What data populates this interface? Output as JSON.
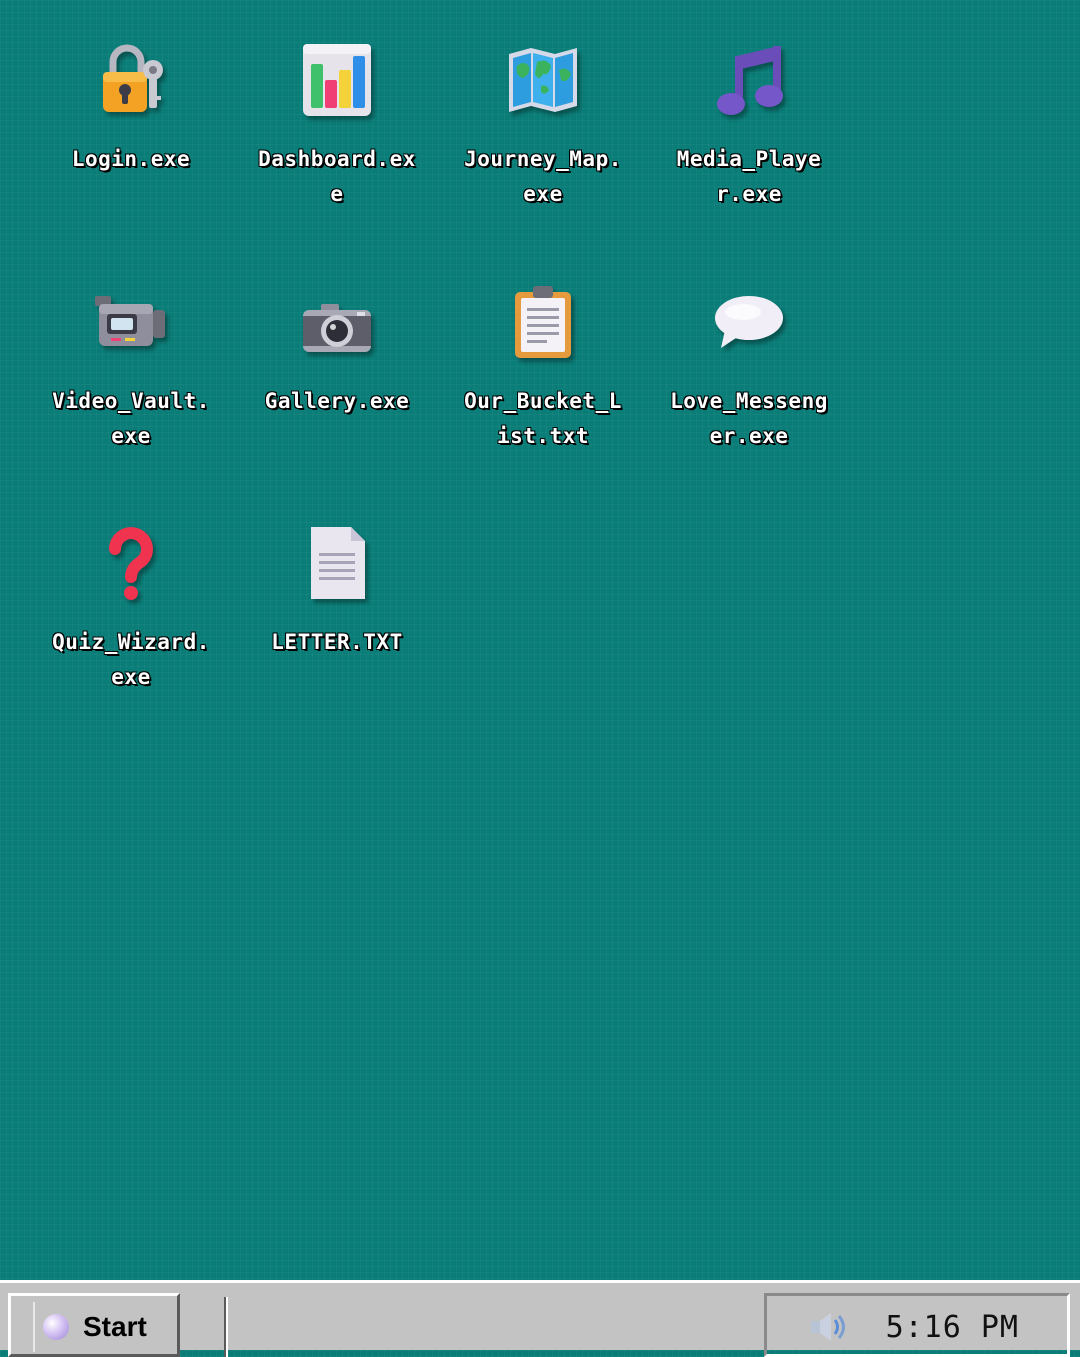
{
  "desktop": {
    "icons": [
      {
        "label": "Login.exe",
        "icon": "lock-key-icon"
      },
      {
        "label": "Dashboard.exe",
        "icon": "bar-chart-icon"
      },
      {
        "label": "Journey_Map.exe",
        "icon": "map-icon"
      },
      {
        "label": "Media_Player.exe",
        "icon": "music-note-icon"
      },
      {
        "label": "Video_Vault.exe",
        "icon": "video-camera-icon"
      },
      {
        "label": "Gallery.exe",
        "icon": "camera-icon"
      },
      {
        "label": "Our_Bucket_List.txt",
        "icon": "clipboard-icon"
      },
      {
        "label": "Love_Messenger.exe",
        "icon": "speech-bubble-icon"
      },
      {
        "label": "Quiz_Wizard.exe",
        "icon": "question-mark-icon"
      },
      {
        "label": "LETTER.TXT",
        "icon": "document-icon"
      }
    ]
  },
  "taskbar": {
    "start_label": "Start",
    "clock": "5:16 PM"
  },
  "colors": {
    "desktop_background": "#0a7d78",
    "taskbar": "#c3c3c3"
  }
}
